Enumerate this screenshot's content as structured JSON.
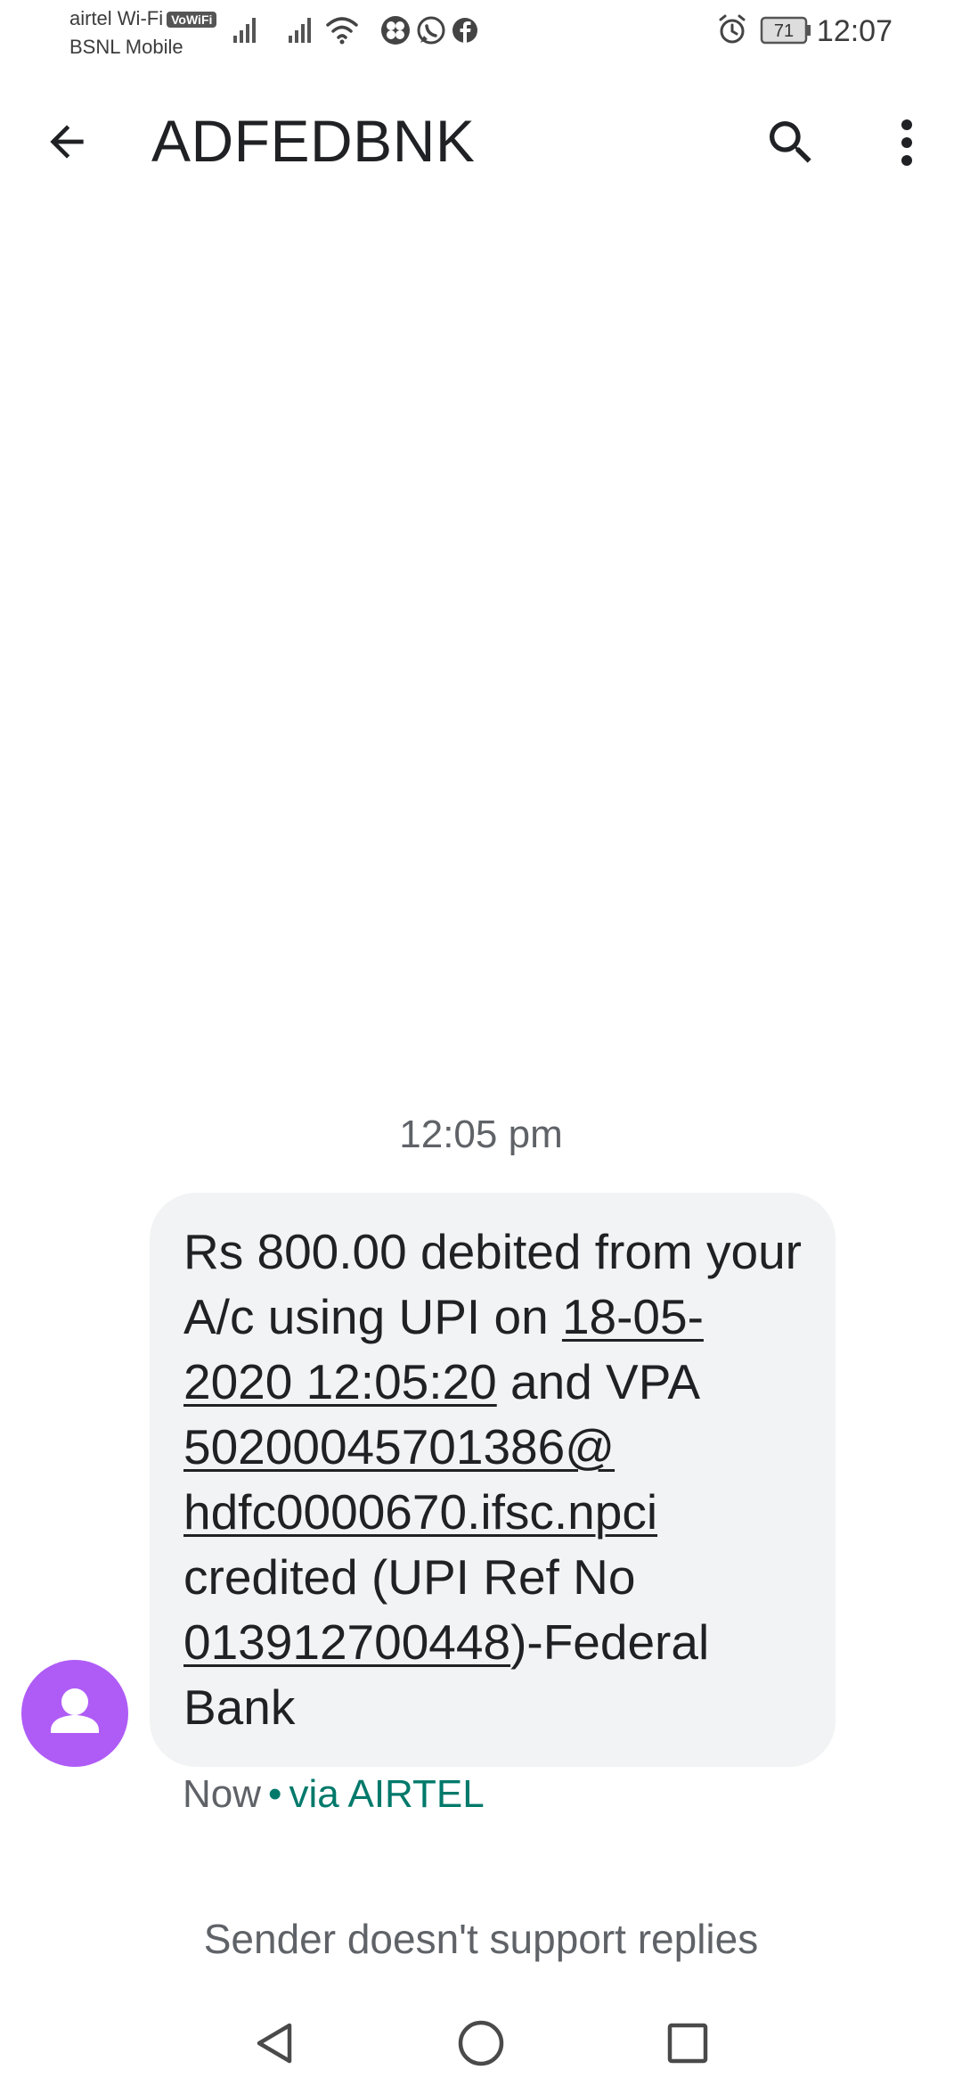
{
  "status_bar": {
    "carrier_primary": "airtel Wi-Fi",
    "vowifi_badge": "VoWiFi",
    "carrier_secondary": "BSNL Mobile",
    "battery_level": "71",
    "time": "12:07",
    "icons_left": [
      "signal-icon",
      "signal-icon",
      "wifi-icon",
      "fan-icon",
      "whatsapp-icon",
      "facebook-icon"
    ],
    "icons_right": [
      "alarm-icon",
      "battery-icon"
    ]
  },
  "app_bar": {
    "title": "ADFEDBNK",
    "back_icon": "arrow-back-icon",
    "search_icon": "search-icon",
    "menu_icon": "more-vert-icon"
  },
  "conversation": {
    "timestamp": "12:05 pm",
    "message": {
      "part1": "Rs 800.00 debited from your A/c using UPI on ",
      "date_link": "18-05-2020 12:05:20",
      "part2": " and VPA ",
      "vpa_link_a": "50200045701386@",
      "vpa_link_b": "hdfc0000670.ifsc.npci",
      "part3": " credited (UPI Ref No ",
      "ref_link": "013912700448",
      "part4": ")-Federal Bank"
    },
    "meta_time": "Now",
    "meta_separator": "•",
    "meta_via": "via AIRTEL"
  },
  "footer": {
    "no_reply_text": "Sender doesn't support replies"
  },
  "colors": {
    "avatar": "#af5cf7",
    "bubble": "#f1f3f4",
    "accent": "#00796b",
    "muted": "#5f6368"
  }
}
